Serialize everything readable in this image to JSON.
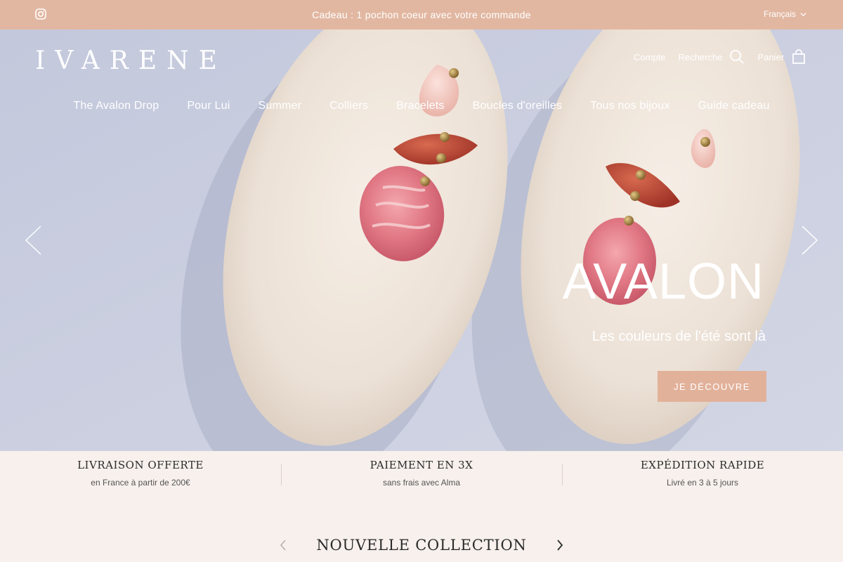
{
  "announcement": {
    "message": "Cadeau : 1 pochon coeur avec votre commande",
    "language": "Français",
    "instagram_icon": "instagram-icon"
  },
  "header": {
    "logo": "IVARENE",
    "account_label": "Compte",
    "search_label": "Recherche",
    "cart_label": "Panier"
  },
  "nav": {
    "items": [
      "The Avalon Drop",
      "Pour Lui",
      "Summer",
      "Colliers",
      "Bracelets",
      "Boucles d'oreilles",
      "Tous nos bijoux",
      "Guide cadeau"
    ]
  },
  "hero": {
    "title": "AVALON",
    "subtitle": "Les couleurs de l'été sont là",
    "cta": "JE DÉCOUVRE"
  },
  "benefits": [
    {
      "title": "LIVRAISON OFFERTE",
      "subtitle": "en France à partir de 200€"
    },
    {
      "title": "PAIEMENT EN 3X",
      "subtitle": "sans frais avec Alma"
    },
    {
      "title": "EXPÉDITION RAPIDE",
      "subtitle": "Livré en 3 à 5 jours"
    }
  ],
  "collection": {
    "title": "NOUVELLE COLLECTION"
  },
  "colors": {
    "announcement_bg": "#e2b7a1",
    "cta_bg": "#e2b19a",
    "page_bg": "#f7f0ec"
  }
}
